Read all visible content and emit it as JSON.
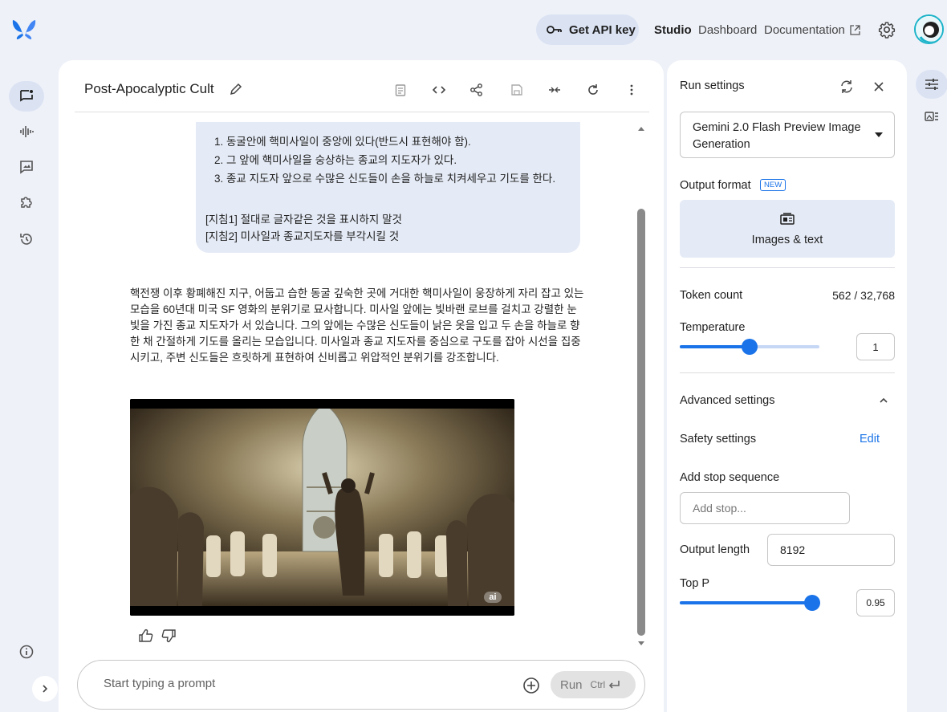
{
  "header": {
    "api_key_label": "Get API key",
    "nav_studio": "Studio",
    "nav_dashboard": "Dashboard",
    "nav_documentation": "Documentation"
  },
  "chat": {
    "title": "Post-Apocalyptic Cult",
    "user_list": [
      "동굴안에 핵미사일이 중앙에 있다(반드시 표현해야 함).",
      "그 앞에 핵미사일을 숭상하는 종교의 지도자가 있다.",
      "종교 지도자 앞으로 수많은 신도들이 손을 하늘로 치켜세우고 기도를 한다."
    ],
    "guideline_1": "[지침1] 절대로 글자같은 것을 표시하지 말것",
    "guideline_2": "[지침2] 미사일과 종교지도자를 부각시킬 것",
    "response_text": "핵전쟁 이후 황폐해진 지구, 어둡고 습한 동굴 깊숙한 곳에 거대한 핵미사일이 웅장하게 자리 잡고 있는 모습을 60년대 미국 SF 영화의 분위기로 묘사합니다. 미사일 앞에는 빛바랜 로브를 걸치고 강렬한 눈빛을 가진 종교 지도자가 서 있습니다. 그의 앞에는 수많은 신도들이 낡은 옷을 입고 두 손을 하늘로 향한 채 간절하게 기도를 올리는 모습입니다. 미사일과 종교 지도자를 중심으로 구도를 잡아 시선을 집중시키고, 주변 신도들은 흐릿하게 표현하여 신비롭고 위압적인 분위기를 강조합니다.",
    "image_badge": "ai"
  },
  "prompt": {
    "placeholder": "Start typing a prompt",
    "run_label": "Run",
    "shortcut": "Ctrl"
  },
  "settings": {
    "title": "Run settings",
    "model_name": "Gemini 2.0 Flash Preview Image Generation",
    "output_format_label": "Output format",
    "new_badge": "NEW",
    "output_format_value": "Images & text",
    "token_count_label": "Token count",
    "token_count_value": "562 / 32,768",
    "temperature_label": "Temperature",
    "temperature_value": "1",
    "temperature_fraction": 0.5,
    "advanced_label": "Advanced settings",
    "safety_label": "Safety settings",
    "safety_edit": "Edit",
    "stop_label": "Add stop sequence",
    "stop_placeholder": "Add stop...",
    "output_length_label": "Output length",
    "output_length_value": "8192",
    "top_p_label": "Top P",
    "top_p_value": "0.95",
    "top_p_fraction": 0.95
  },
  "colors": {
    "accent": "#1a73e8",
    "pill_bg": "#dbe3f3",
    "bubble_bg": "#e5ebf6"
  }
}
